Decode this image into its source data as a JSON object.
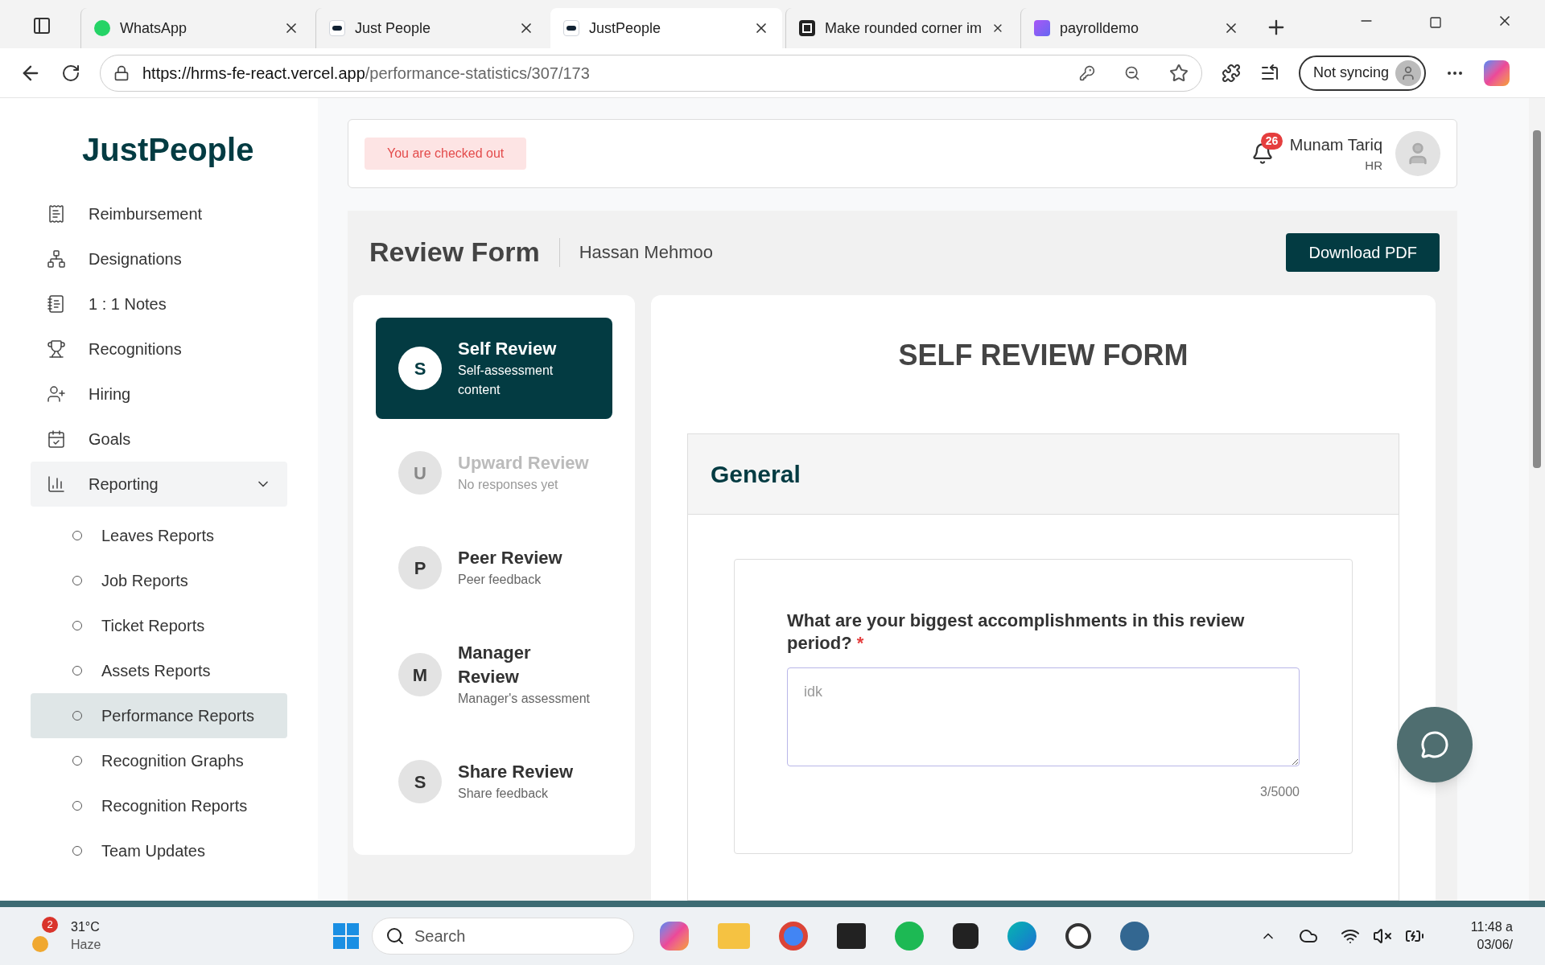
{
  "browser": {
    "tabs": [
      {
        "title": "WhatsApp",
        "selected": false
      },
      {
        "title": "Just People",
        "selected": false
      },
      {
        "title": "JustPeople",
        "selected": true
      },
      {
        "title": "Make rounded corner im",
        "selected": false
      },
      {
        "title": "payrolldemo",
        "selected": false
      }
    ],
    "url_host": "https://hrms-fe-react.vercel.app",
    "url_path": "/performance-statistics/307/173",
    "profile": "Not syncing"
  },
  "sidebar": {
    "logo": "JustPeople",
    "items": [
      {
        "label": "Reimbursement",
        "selected": false
      },
      {
        "label": "Designations",
        "selected": false
      },
      {
        "label": "1 : 1 Notes",
        "selected": false
      },
      {
        "label": "Recognitions",
        "selected": false
      },
      {
        "label": "Hiring",
        "selected": false
      },
      {
        "label": "Goals",
        "selected": false
      },
      {
        "label": "Reporting",
        "selected": false,
        "expanded": true,
        "children": [
          {
            "label": "Leaves Reports",
            "selected": false
          },
          {
            "label": "Job Reports",
            "selected": false
          },
          {
            "label": "Ticket Reports",
            "selected": false
          },
          {
            "label": "Assets Reports",
            "selected": false
          },
          {
            "label": "Performance Reports",
            "selected": true
          },
          {
            "label": "Recognition Graphs",
            "selected": false
          },
          {
            "label": "Recognition Reports",
            "selected": false
          },
          {
            "label": "Team Updates",
            "selected": false
          }
        ]
      }
    ]
  },
  "header": {
    "status": "You are checked out",
    "notifications": "26",
    "user_name": "Munam Tariq",
    "user_role": "HR"
  },
  "review": {
    "title": "Review Form",
    "employee": "Hassan Mehmoo",
    "download": "Download PDF",
    "steps": [
      {
        "letter": "S",
        "title": "Self Review",
        "subtitle": "Self-assessment content",
        "selected": true,
        "disabled": false
      },
      {
        "letter": "U",
        "title": "Upward Review",
        "subtitle": "No responses yet",
        "selected": false,
        "disabled": true
      },
      {
        "letter": "P",
        "title": "Peer Review",
        "subtitle": "Peer feedback",
        "selected": false,
        "disabled": false
      },
      {
        "letter": "M",
        "title": "Manager Review",
        "subtitle": "Manager's assessment",
        "selected": false,
        "disabled": false
      },
      {
        "letter": "S",
        "title": "Share Review",
        "subtitle": "Share feedback",
        "selected": false,
        "disabled": false
      }
    ],
    "form_title": "SELF REVIEW FORM",
    "section": "General",
    "question": {
      "text": "What are your biggest accomplishments in this review period?",
      "required_mark": "*",
      "value": "idk",
      "count": "3/5000"
    }
  },
  "taskbar": {
    "weather_badge": "2",
    "temperature": "31°C",
    "condition": "Haze",
    "search_placeholder": "Search",
    "time": "11:48 a",
    "date": "03/06/"
  }
}
